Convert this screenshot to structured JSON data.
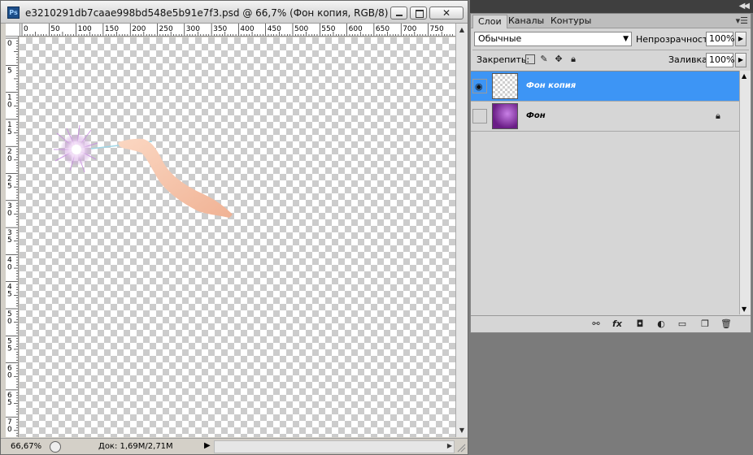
{
  "document": {
    "title": "e3210291db7caae998bd548e5b91e7f3.psd @ 66,7% (Фон копия, RGB/8)",
    "ps_logo": "Ps",
    "close_glyph": "✕",
    "ruler_h_labels": [
      "0",
      "50",
      "100",
      "150",
      "200",
      "250",
      "300",
      "350",
      "400",
      "450",
      "500",
      "550",
      "600",
      "650",
      "700",
      "750"
    ],
    "ruler_v_labels": [
      "0",
      "5",
      "10",
      "15",
      "20",
      "25",
      "30",
      "35",
      "40",
      "45",
      "50",
      "55",
      "60",
      "65",
      "70"
    ],
    "status": {
      "zoom": "66,67%",
      "doc_info": "Док: 1,69M/2,71M"
    }
  },
  "layers_panel": {
    "tabs": [
      {
        "label": "Слои",
        "active": true
      },
      {
        "label": "Каналы",
        "active": false
      },
      {
        "label": "Контуры",
        "active": false
      }
    ],
    "blend_mode": "Обычные",
    "opacity_label": "Непрозрачность:",
    "opacity_value": "100%",
    "lock_label": "Закрепить:",
    "fill_label": "Заливка:",
    "fill_value": "100%",
    "layers": [
      {
        "name": "Фон копия",
        "visible": true,
        "selected": true,
        "locked": false
      },
      {
        "name": "Фон",
        "visible": false,
        "selected": false,
        "locked": true
      }
    ]
  },
  "colors": {
    "selection_blue": "#3d95f5",
    "workspace_gray": "#7b7b7b",
    "panel_bg": "#d6d6d6"
  },
  "icons": [
    "ps-logo-icon",
    "minimize-icon",
    "maximize-icon",
    "close-icon",
    "eye-icon",
    "lock-icon",
    "link-icon",
    "fx-icon",
    "mask-icon",
    "adjustment-icon",
    "folder-icon",
    "new-layer-icon",
    "trash-icon"
  ]
}
